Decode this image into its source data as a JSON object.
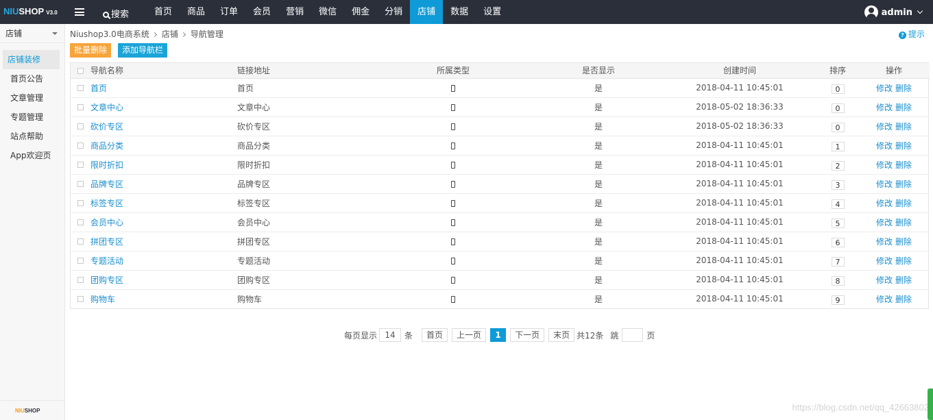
{
  "brand": {
    "logo_prefix": "NIU",
    "logo_suffix": "SHOP",
    "version": "V3.0"
  },
  "topnav": {
    "search_label": "搜索",
    "items": [
      "首页",
      "商品",
      "订单",
      "会员",
      "营销",
      "微信",
      "佣金",
      "分销",
      "店铺",
      "数据",
      "设置"
    ],
    "active": "店铺",
    "user": "admin"
  },
  "sidebar": {
    "header": "店铺",
    "items": [
      "店铺装修",
      "首页公告",
      "文章管理",
      "专题管理",
      "站点帮助",
      "App欢迎页"
    ],
    "active_index": 0,
    "footer_logo_prefix": "NIU",
    "footer_logo_suffix": "SHOP"
  },
  "breadcrumb": [
    "Niushop3.0电商系统",
    "店铺",
    "导航管理"
  ],
  "hint_label": "提示",
  "actions": {
    "batch_delete": "批量删除",
    "add_nav": "添加导航栏"
  },
  "table": {
    "headers": {
      "name": "导航名称",
      "url": "链接地址",
      "type": "所属类型",
      "show": "是否显示",
      "created": "创建时间",
      "sort": "排序",
      "ops": "操作"
    },
    "edit_label": "修改",
    "delete_label": "删除",
    "rows": [
      {
        "name": "首页",
        "url": "首页",
        "show": "是",
        "created": "2018-04-11 10:45:01",
        "sort": "0"
      },
      {
        "name": "文章中心",
        "url": "文章中心",
        "show": "是",
        "created": "2018-05-02 18:36:33",
        "sort": "0"
      },
      {
        "name": "砍价专区",
        "url": "砍价专区",
        "show": "是",
        "created": "2018-05-02 18:36:33",
        "sort": "0"
      },
      {
        "name": "商品分类",
        "url": "商品分类",
        "show": "是",
        "created": "2018-04-11 10:45:01",
        "sort": "1"
      },
      {
        "name": "限时折扣",
        "url": "限时折扣",
        "show": "是",
        "created": "2018-04-11 10:45:01",
        "sort": "2"
      },
      {
        "name": "品牌专区",
        "url": "品牌专区",
        "show": "是",
        "created": "2018-04-11 10:45:01",
        "sort": "3"
      },
      {
        "name": "标签专区",
        "url": "标签专区",
        "show": "是",
        "created": "2018-04-11 10:45:01",
        "sort": "4"
      },
      {
        "name": "会员中心",
        "url": "会员中心",
        "show": "是",
        "created": "2018-04-11 10:45:01",
        "sort": "5"
      },
      {
        "name": "拼团专区",
        "url": "拼团专区",
        "show": "是",
        "created": "2018-04-11 10:45:01",
        "sort": "6"
      },
      {
        "name": "专题活动",
        "url": "专题活动",
        "show": "是",
        "created": "2018-04-11 10:45:01",
        "sort": "7"
      },
      {
        "name": "团购专区",
        "url": "团购专区",
        "show": "是",
        "created": "2018-04-11 10:45:01",
        "sort": "8"
      },
      {
        "name": "购物车",
        "url": "购物车",
        "show": "是",
        "created": "2018-04-11 10:45:01",
        "sort": "9"
      }
    ]
  },
  "pager": {
    "per_page_label": "每页显示",
    "per_page_value": "14",
    "per_page_unit": "条",
    "first": "首页",
    "prev": "上一页",
    "current": "1",
    "next": "下一页",
    "last": "末页",
    "total": "共12条",
    "jump_label": "跳",
    "jump_unit": "页"
  },
  "watermark": "https://blog.csdn.net/qq_42663802",
  "colors": {
    "topbar": "#2b2f3a",
    "accent": "#0e9bd7",
    "orange": "#f7a43b",
    "link": "#1a8fcf"
  }
}
